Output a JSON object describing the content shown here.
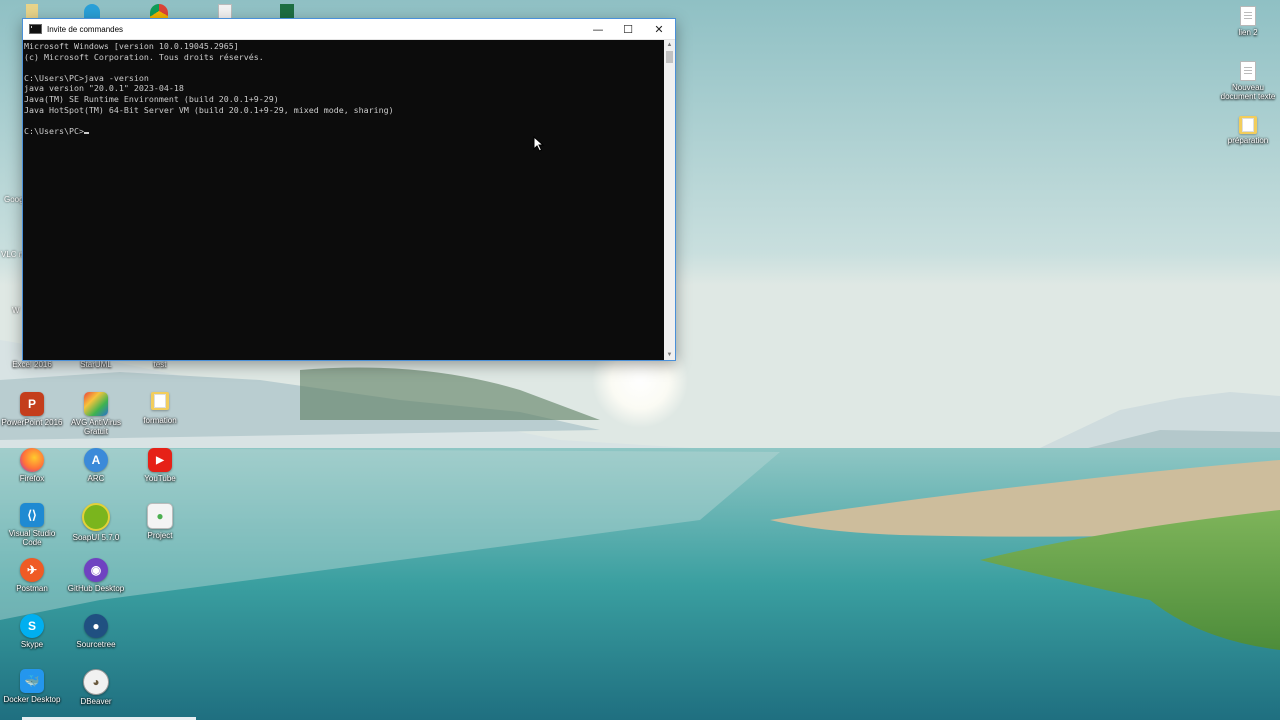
{
  "window": {
    "title": "Invite de commandes",
    "controls": {
      "minimize": "—",
      "maximize": "☐",
      "close": "✕"
    }
  },
  "console": {
    "lines": [
      "Microsoft Windows [version 10.0.19045.2965]",
      "(c) Microsoft Corporation. Tous droits réservés.",
      "",
      "C:\\Users\\PC>java -version",
      "java version \"20.0.1\" 2023-04-18",
      "Java(TM) SE Runtime Environment (build 20.0.1+9-29)",
      "Java HotSpot(TM) 64-Bit Server VM (build 20.0.1+9-29, mixed mode, sharing)",
      "",
      "C:\\Users\\PC>"
    ]
  },
  "desktop_left": {
    "partial_labels": [
      "Goog",
      "VLC m",
      "W"
    ],
    "icons": [
      {
        "label": "Excel 2016",
        "icon": "excel-icon",
        "color": "#1d6f42"
      },
      {
        "label": "StarUML",
        "icon": "staruml-icon",
        "color": "#e8a33a"
      },
      {
        "label": "test",
        "icon": "folder-icon",
        "color": "#f2cd5c"
      },
      {
        "label": "PowerPoint 2016",
        "icon": "powerpoint-icon",
        "color": "#c43e1c"
      },
      {
        "label": "AVG AntiVirus Gratuit",
        "icon": "avg-antivirus-icon",
        "color": "#2a6fcf"
      },
      {
        "label": "formation",
        "icon": "folder-icon",
        "color": "#f2cd5c"
      },
      {
        "label": "Firefox",
        "icon": "firefox-icon",
        "color": "#ff7139"
      },
      {
        "label": "ARC",
        "icon": "arc-icon",
        "color": "#3b8ad9"
      },
      {
        "label": "YouTube",
        "icon": "youtube-icon",
        "color": "#e62117"
      },
      {
        "label": "Visual Studio Code",
        "icon": "vscode-icon",
        "color": "#1f8ad2"
      },
      {
        "label": "SoapUI 5.7.0",
        "icon": "soapui-icon",
        "color": "#7ab51d"
      },
      {
        "label": "Project",
        "icon": "project-icon",
        "color": "#4caf50"
      },
      {
        "label": "Postman",
        "icon": "postman-icon",
        "color": "#ef5b25"
      },
      {
        "label": "GitHub Desktop",
        "icon": "github-desktop-icon",
        "color": "#6f42c1"
      },
      {
        "label": "Skype",
        "icon": "skype-icon",
        "color": "#00aff0"
      },
      {
        "label": "Sourcetree",
        "icon": "sourcetree-icon",
        "color": "#205081"
      },
      {
        "label": "Docker Desktop",
        "icon": "docker-icon",
        "color": "#2496ed"
      },
      {
        "label": "DBeaver",
        "icon": "dbeaver-icon",
        "color": "#6b5a3e"
      }
    ]
  },
  "desktop_right": {
    "icons": [
      {
        "label": "lien 2",
        "icon": "text-file-icon"
      },
      {
        "label": "Nouveau document texte",
        "icon": "text-file-icon"
      },
      {
        "label": "préparation",
        "icon": "folder-icon"
      }
    ]
  }
}
